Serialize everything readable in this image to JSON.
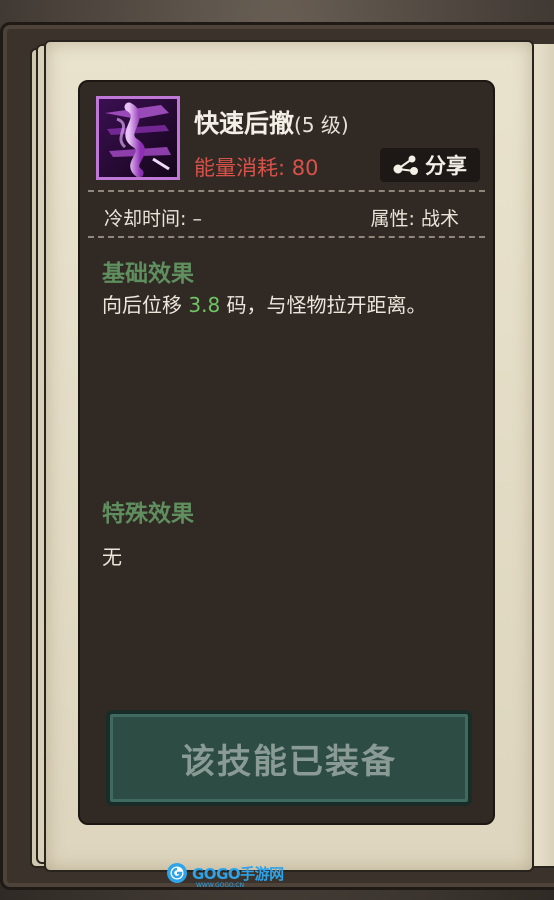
{
  "skill": {
    "name": "快速后撤",
    "level": "(5 级)",
    "energy_cost": "能量消耗: 80",
    "icon": "retreat-dash-icon"
  },
  "share": {
    "label": "分享",
    "icon": "share-icon"
  },
  "stats": {
    "cooldown": "冷却时间: –",
    "attribute": "属性: 战术"
  },
  "basic_effect": {
    "title": "基础效果",
    "text_before": "向后位移 ",
    "value": "3.8",
    "text_after": " 码，与怪物拉开距离。"
  },
  "special_effect": {
    "title": "特殊效果",
    "text": "无"
  },
  "equip_button": {
    "label": "该技能已装备"
  },
  "watermark": {
    "text": "GOGO手游网",
    "sub": "WWW.GOGO.CN"
  },
  "colors": {
    "energy": "#d9524a",
    "highlight": "#6fc464",
    "section_title": "#5f8f5f",
    "icon_border": "#c078d8",
    "equip_button_bg": "#2c4c44"
  }
}
